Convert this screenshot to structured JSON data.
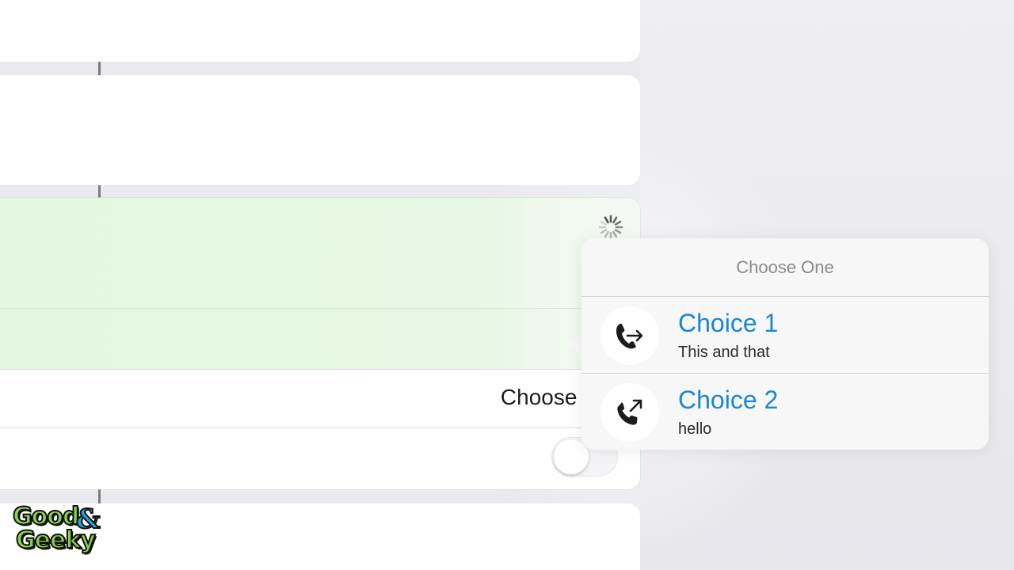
{
  "background": {
    "cards": [
      "card-1",
      "card-2",
      "card-3",
      "card-4"
    ],
    "active_cell": {
      "choose_label": "Choose O",
      "tint_color": "#e4f8e1",
      "toggle_state": "off"
    },
    "spinner_icon": "activity-spinner-icon"
  },
  "popover": {
    "title": "Choose One",
    "options": [
      {
        "title": "Choice 1",
        "subtitle": "This and that",
        "icon": "phone-forward-icon"
      },
      {
        "title": "Choice 2",
        "subtitle": "hello",
        "icon": "phone-outgoing-icon"
      }
    ],
    "accent_color": "#1a86d8"
  },
  "watermark": {
    "line1": "Good",
    "ampersand": "&",
    "line2": "Geeky"
  }
}
